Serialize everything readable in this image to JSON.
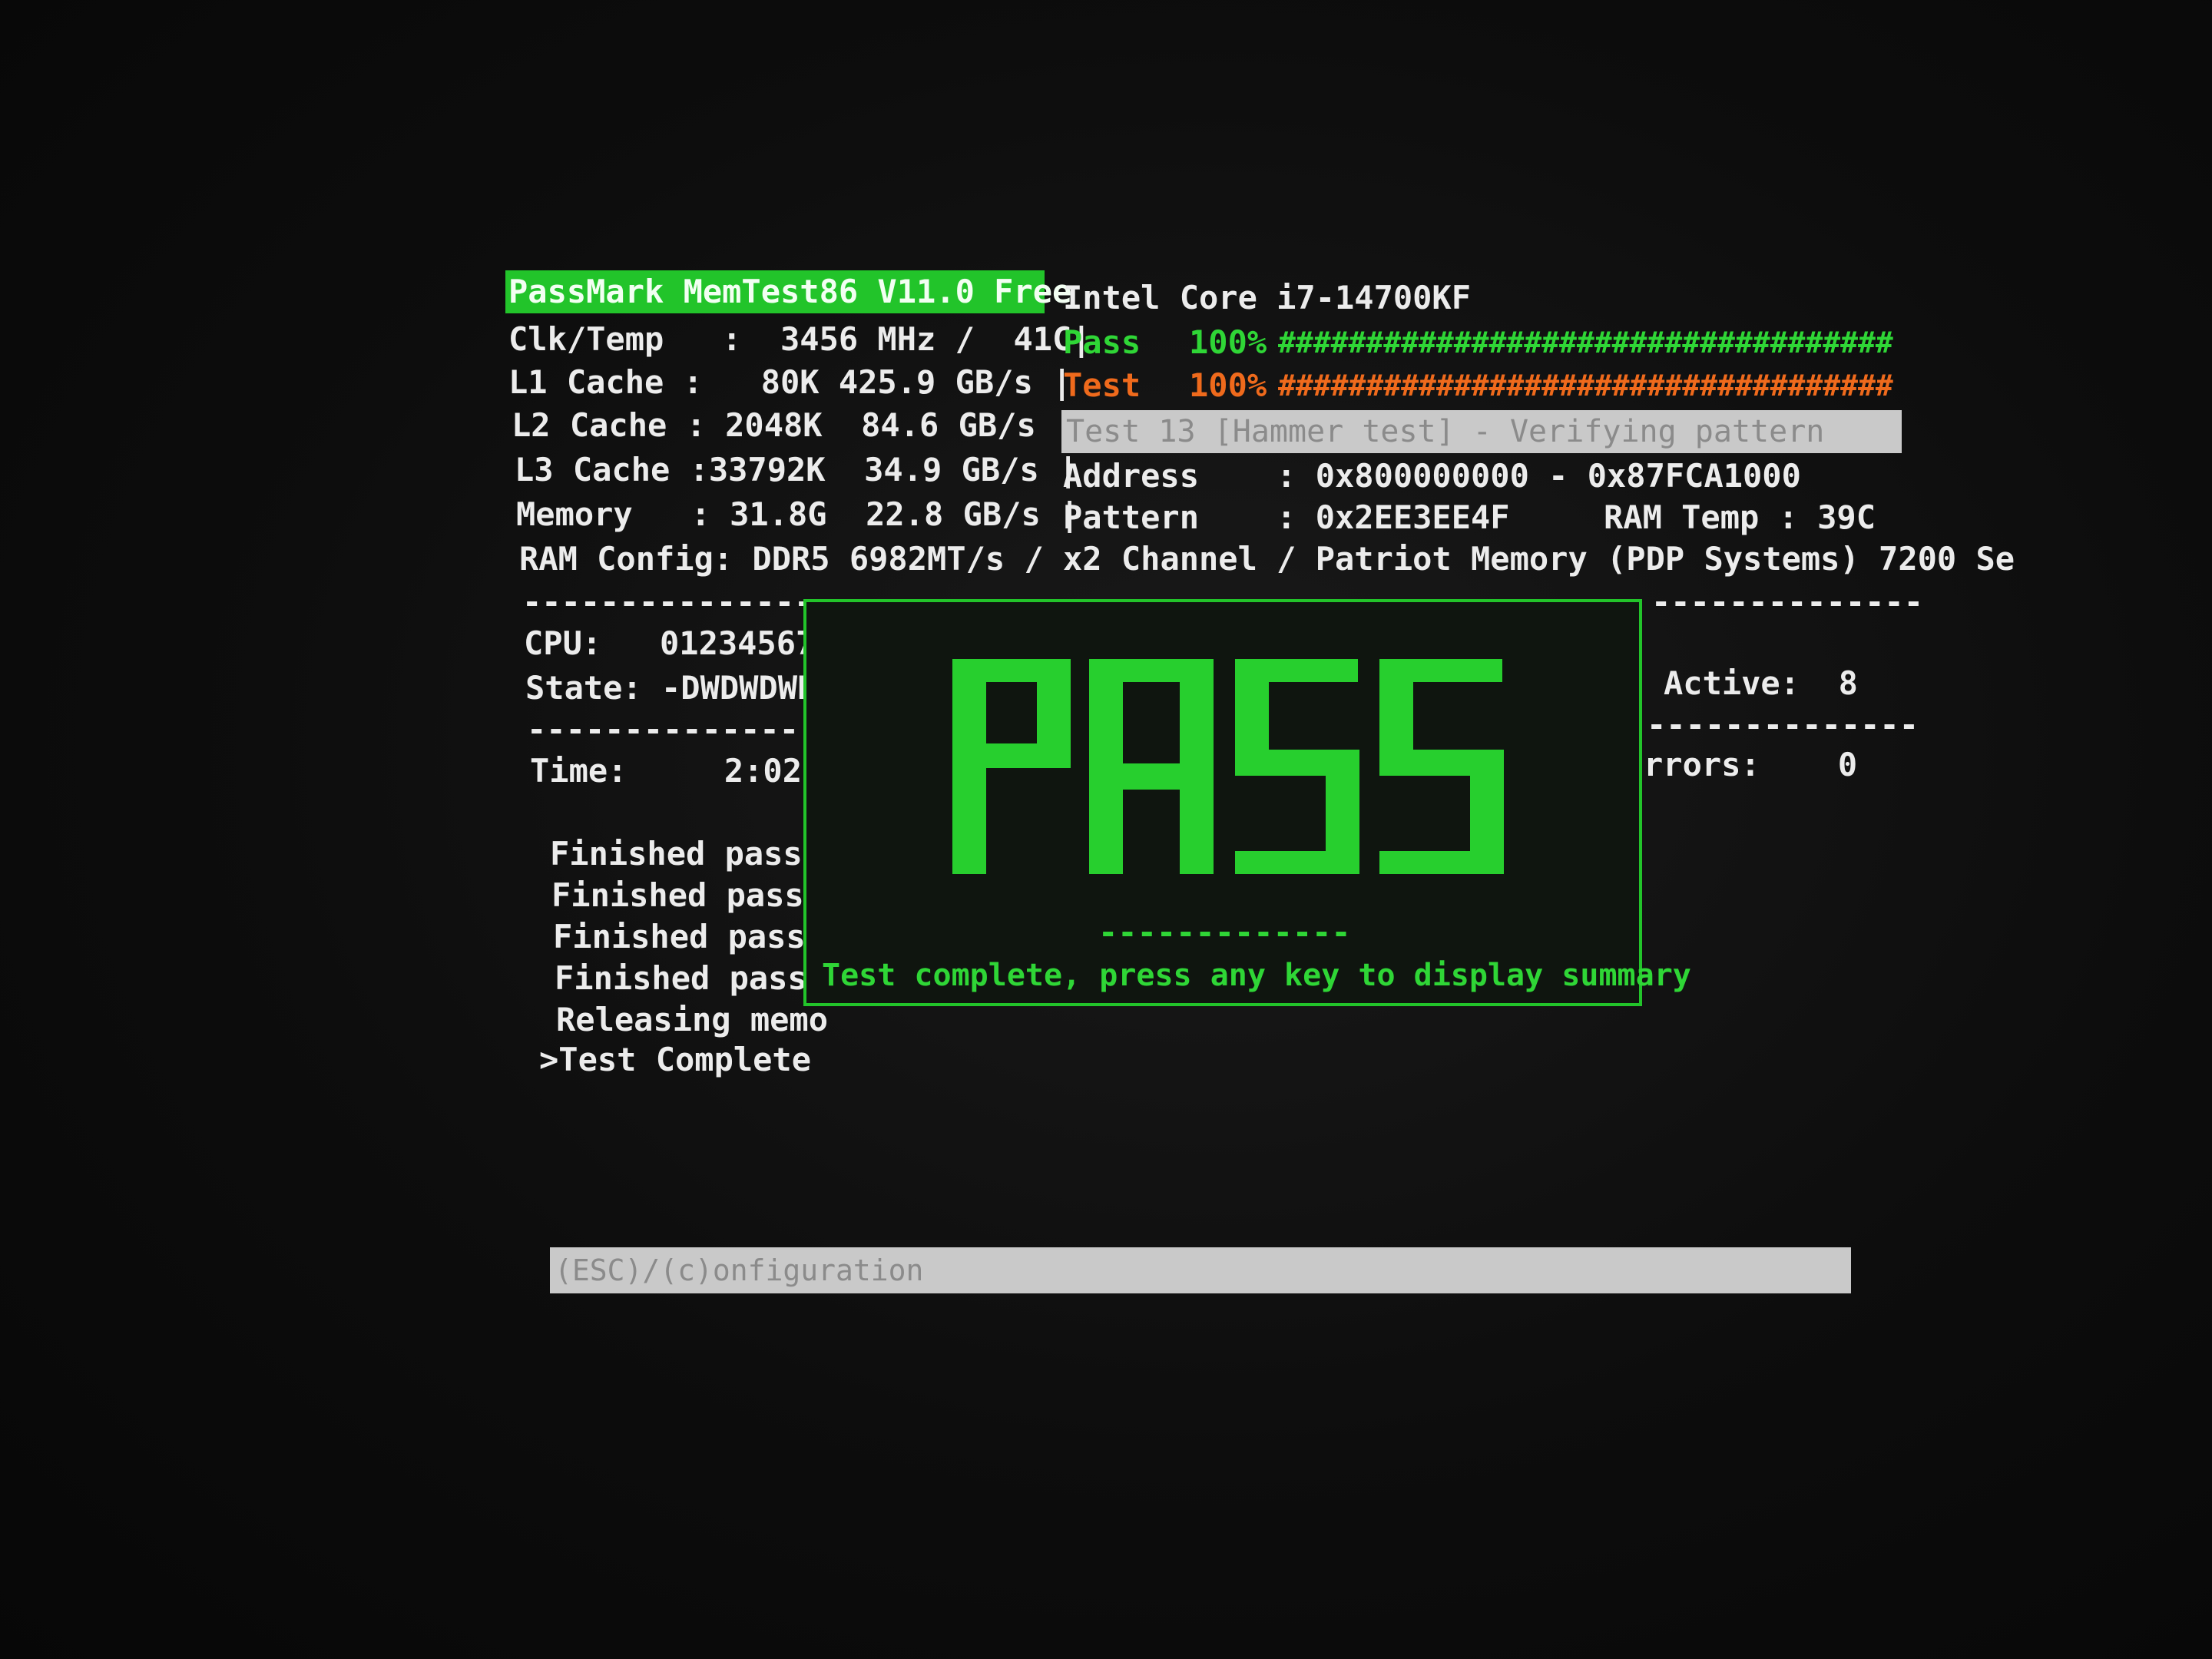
{
  "header": {
    "app_title": "PassMark MemTest86 V11.0 Free",
    "cpu_name": "Intel Core i7-14700KF"
  },
  "system_info": {
    "clk_temp": "Clk/Temp   :  3456 MHz /  41C|",
    "l1_cache": "L1 Cache :   80K 425.9 GB/s |",
    "l2_cache": "L2 Cache : 2048K  84.6 GB/s |",
    "l3_cache": "L3 Cache :33792K  34.9 GB/s |",
    "memory": "Memory   : 31.8G  22.8 GB/s |",
    "ram_config": "RAM Config: DDR5 6982MT/s / x2 Channel / Patriot Memory (PDP Systems) 7200 Se"
  },
  "progress": {
    "pass_label": "Pass",
    "pass_percent": "100%",
    "pass_bar": "###################################",
    "pass_fraction": 1.0,
    "test_label": "Test",
    "test_percent": "100%",
    "test_bar": "###################################",
    "test_fraction": 1.0,
    "current_test": "Test 13 [Hammer test] - Verifying pattern"
  },
  "address": {
    "address_line": "Address    : 0x800000000 - 0x87FCA1000",
    "pattern_line": "Pattern    : 0x2EE3EE4F",
    "ram_temp": "RAM Temp : 39C"
  },
  "left_panel": {
    "divider": "---------------",
    "cpu_line": "CPU:   01234567",
    "state_line": "State: -DWDWDWD",
    "time_line": "Time:     2:02:",
    "log": [
      "Finished pass",
      "Finished pass",
      "Finished pass",
      "Finished pass",
      "Releasing memo",
      ">Test Complete"
    ]
  },
  "right_panel": {
    "divider": "--------------",
    "active_line": "Active:  8",
    "errors_line": "rrors:    0"
  },
  "result": {
    "big_text": "PASS",
    "divider": "-------------",
    "message": "Test complete, press any key to display summary"
  },
  "footer": {
    "hint": "(ESC)/(c)onfiguration"
  },
  "colors": {
    "accent_green": "#22c42a",
    "bright_green": "#2fd636",
    "orange": "#ef6a1c",
    "bar_gray": "#c9c9c9"
  }
}
